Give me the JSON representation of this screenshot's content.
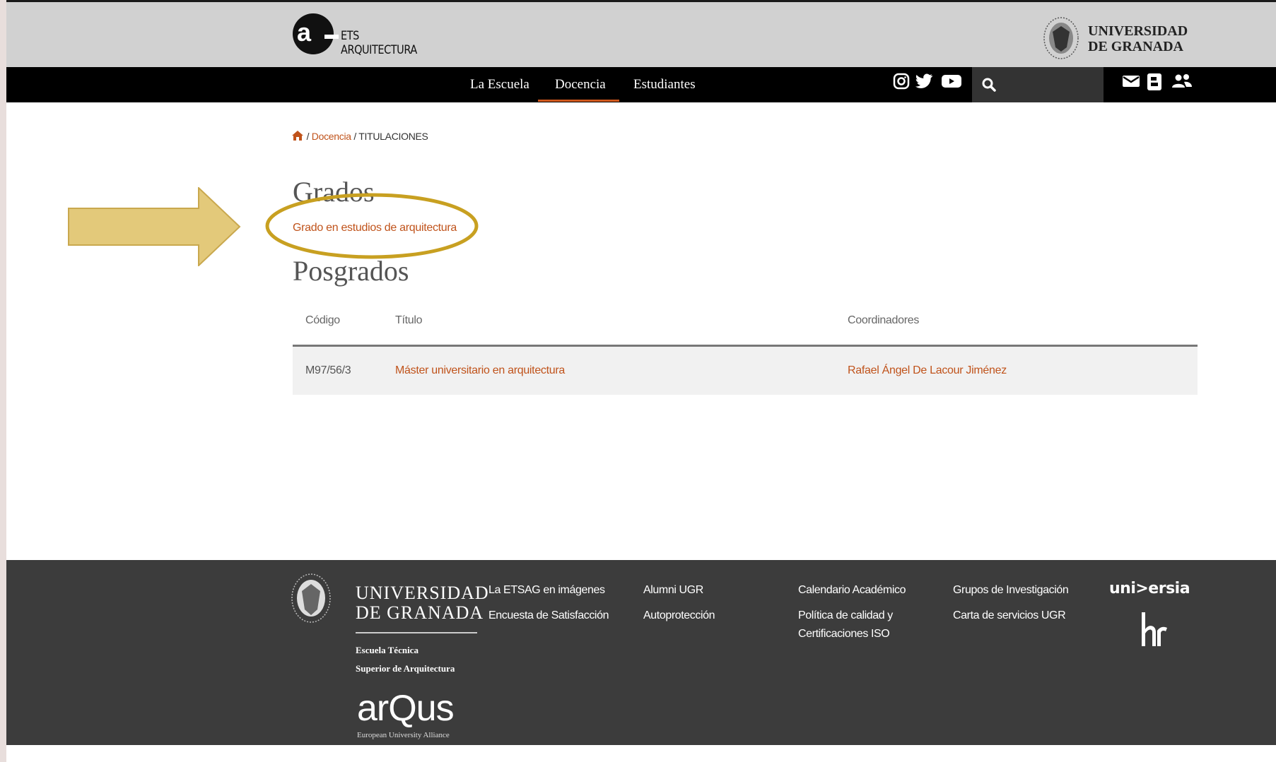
{
  "header": {
    "logo_letter": "a",
    "logo_line1": "ETS",
    "logo_line2": "ARQUITECTURA",
    "ugr_line1": "UNIVERSIDAD",
    "ugr_line2": "DE GRANADA"
  },
  "nav": {
    "items": [
      {
        "label": "La Escuela"
      },
      {
        "label": "Docencia"
      },
      {
        "label": "Estudiantes"
      }
    ],
    "active": "Docencia",
    "social_icons": [
      "instagram-icon",
      "twitter-icon",
      "youtube-icon"
    ],
    "search_placeholder": "",
    "right_icons": [
      "mail-icon",
      "id-card-icon",
      "users-icon"
    ]
  },
  "breadcrumb": {
    "home_icon": "home-icon",
    "separator": "/",
    "link": "Docencia",
    "current": "TITULACIONES"
  },
  "grados": {
    "heading": "Grados",
    "link": "Grado en estudios de arquitectura"
  },
  "posgrados": {
    "heading": "Posgrados",
    "columns": [
      "Código",
      "Título",
      "Coordinadores"
    ],
    "rows": [
      {
        "code": "M97/56/3",
        "title": "Máster universitario en arquitectura",
        "coordinator": "Rafael Ángel De Lacour Jiménez"
      }
    ]
  },
  "footer": {
    "ugr_line1": "UNIVERSIDAD",
    "ugr_line2": "DE GRANADA",
    "school_line1": "Escuela Técnica",
    "school_line2": "Superior de Arquitectura",
    "arqus": "arQus",
    "arqus_sub": "European University Alliance",
    "links_col1": [
      "La ETSAG en imágenes",
      "Encuesta de Satisfacción"
    ],
    "links_col2": [
      "Alumni UGR",
      "Autoprotección"
    ],
    "links_col3": [
      "Calendario Académico",
      "Política de calidad y",
      "Certificaciones ISO"
    ],
    "links_col4": [
      "Grupos de Investigación",
      "Carta de servicios UGR"
    ],
    "universia": "uni>ersia"
  },
  "colors": {
    "accent": "#c0531b",
    "annotation": "#c8a021",
    "arrow_fill": "#e3c97a"
  }
}
